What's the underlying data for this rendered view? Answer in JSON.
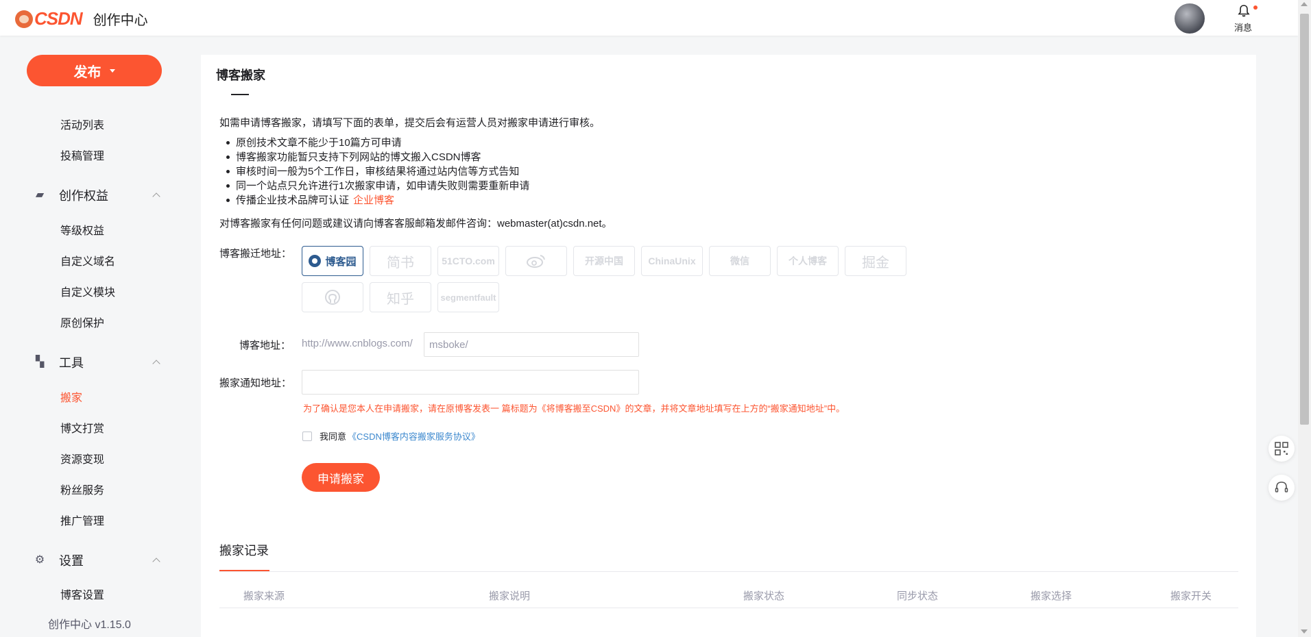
{
  "header": {
    "logo_text": "CSDN",
    "app_title": "创作中心",
    "notifications_label": "消息"
  },
  "sidebar": {
    "publish_label": "发布",
    "items": [
      {
        "label": "活动列表"
      },
      {
        "label": "投稿管理"
      },
      {
        "group": "创作权益"
      },
      {
        "label": "等级权益"
      },
      {
        "label": "自定义域名"
      },
      {
        "label": "自定义模块"
      },
      {
        "label": "原创保护"
      },
      {
        "group": "工具"
      },
      {
        "label": "搬家",
        "active": true
      },
      {
        "label": "博文打赏"
      },
      {
        "label": "资源变现"
      },
      {
        "label": "粉丝服务"
      },
      {
        "label": "推广管理"
      },
      {
        "group": "设置"
      },
      {
        "label": "博客设置"
      }
    ],
    "version": "创作中心 v1.15.0"
  },
  "main": {
    "title": "博客搬家",
    "intro": "如需申请博客搬家，请填写下面的表单，提交后会有运营人员对搬家申请进行审核。",
    "rules": [
      "原创技术文章不能少于10篇方可申请",
      "博客搬家功能暂只支持下列网站的博文搬入CSDN博客",
      "审核时间一般为5个工作日，审核结果将通过站内信等方式告知",
      "同一个站点只允许进行1次搬家申请，如申请失败则需要重新申请",
      "传播企业技术品牌可认证"
    ],
    "enterprise_link": "企业博客",
    "contact": "对博客搬家有任何问题或建议请向博客客服邮箱发邮件咨询：webmaster(at)csdn.net。",
    "source_label": "博客搬迁地址：",
    "sites": [
      "博客园",
      "简书",
      "51CTO.com",
      "微博",
      "开源中国",
      "ChinaUnix",
      "微信",
      "个人博客",
      "掘金",
      "GitHub",
      "知乎",
      "segmentfault"
    ],
    "selected_site": "博客园",
    "blog_url_label": "博客地址：",
    "blog_url_prefix": "http://www.cnblogs.com/",
    "blog_url_value": "msboke/",
    "notify_url_label": "搬家通知地址：",
    "notify_url_value": "",
    "notice": "为了确认是您本人在申请搬家，请在原博客发表一 篇标题为《将博客搬至CSDN》的文章，并将文章地址填写在上方的“搬家通知地址”中。",
    "agree_label": "我同意",
    "agree_protocol": "《CSDN博客内容搬家服务协议》",
    "apply_label": "申请搬家",
    "records_title": "搬家记录",
    "columns": [
      "搬家来源",
      "搬家说明",
      "搬家状态",
      "同步状态",
      "搬家选择",
      "搬家开关"
    ]
  },
  "colors": {
    "brand": "#fc5531",
    "link": "#3c88ce",
    "selected_site": "#2d5b8f"
  }
}
